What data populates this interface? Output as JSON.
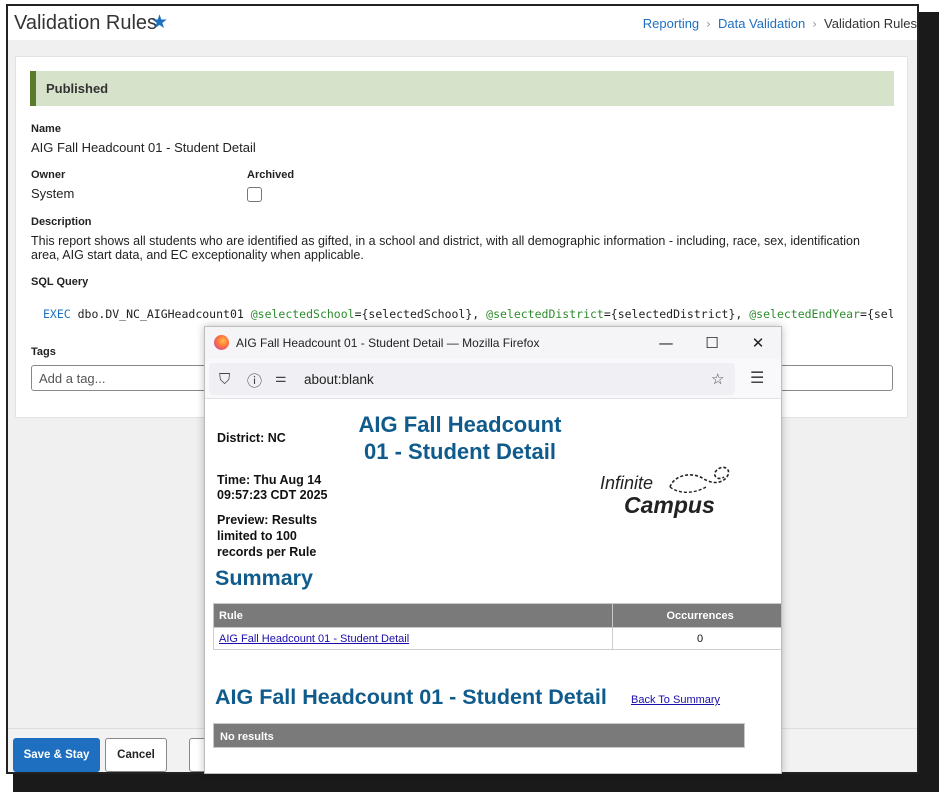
{
  "header": {
    "title": "Validation Rules",
    "breadcrumb": [
      "Reporting",
      "Data Validation",
      "Validation Rules"
    ]
  },
  "form": {
    "status": "Published",
    "name_label": "Name",
    "name_value": "AIG Fall Headcount 01 - Student Detail",
    "owner_label": "Owner",
    "owner_value": "System",
    "archived_label": "Archived",
    "archived_checked": false,
    "description_label": "Description",
    "description_value": "This report shows all students who are identified as gifted, in a school and district, with all demographic information - including, race, sex, identification area, AIG start data, and EC exceptionality when applicable.",
    "sql_label": "SQL Query",
    "sql": {
      "exec": "EXEC",
      "proc": " dbo.DV_NC_AIGHeadcount01 ",
      "p1": "@selectedSchool",
      "p1_val": "={selectedSchool}, ",
      "p2": "@selectedDistrict",
      "p2_val": "={selectedDistrict}, ",
      "p3": "@selectedEndYear",
      "p3_val": "={selectedEndYear}"
    },
    "tags_label": "Tags",
    "tags_placeholder": "Add a tag..."
  },
  "footer": {
    "save_stay_label": "Save & Stay",
    "cancel_label": "Cancel"
  },
  "popup": {
    "window_title": "AIG Fall Headcount 01 - Student Detail — Mozilla Firefox",
    "url": "about:blank",
    "report": {
      "district": "District: NC",
      "time": "Time: Thu Aug 14 09:57:23 CDT 2025",
      "preview": "Preview: Results limited to 100 records per Rule",
      "title": "AIG Fall Headcount 01 - Student Detail",
      "logo_line1": "Infinite",
      "logo_line2": "Campus",
      "summary_heading": "Summary",
      "table_headers": [
        "Rule",
        "Occurrences"
      ],
      "table_rows": [
        {
          "rule": "AIG Fall Headcount 01 - Student Detail",
          "occurrences": "0"
        }
      ],
      "detail_heading": "AIG Fall Headcount 01 - Student Detail",
      "back_link": "Back To Summary",
      "no_results": "No results"
    }
  },
  "colors": {
    "primary": "#1f6fc0",
    "published_bg": "#d7e2cb",
    "published_border": "#5a7a2c",
    "report_heading": "#0f5b8c",
    "table_header": "#7a7a7a"
  }
}
